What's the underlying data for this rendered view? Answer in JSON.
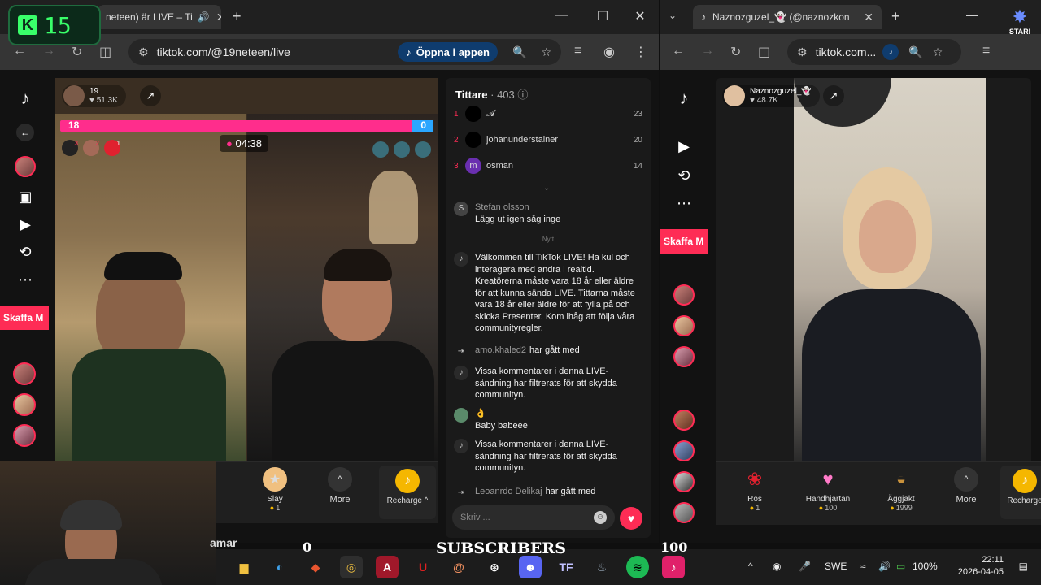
{
  "overlay": {
    "counter_logo": "K",
    "counter_value": "15",
    "stari_label": "STARI"
  },
  "left_window": {
    "tab_title": "neteen) är LIVE – Ti",
    "url": "tiktok.com/@19neteen/live",
    "open_in_app": "Öppna i appen",
    "win_controls": {
      "minimize": "—",
      "maximize": "☐",
      "close": "✕"
    }
  },
  "right_window": {
    "tab_title": "Naznozguzel_👻 (@naznozkon",
    "url": "tiktok.com..."
  },
  "tiktok_rail": {
    "get_coins_button": "Skaffa M"
  },
  "live_left": {
    "host_name": "19",
    "host_likes": "51.3K",
    "pk_left_score": "18",
    "pk_right_score": "0",
    "pk_timer": "04:38",
    "rank_badges": [
      "3",
      "2",
      "1"
    ],
    "gifts": [
      {
        "name": "Slay",
        "price": "1",
        "icon": "slay-icon"
      }
    ],
    "more_label": "More",
    "recharge_label": "Recharge ^"
  },
  "chat": {
    "title": "Tittare",
    "viewer_count": "· 403",
    "top_viewers": [
      {
        "rank": "1",
        "name": "𝓐",
        "score": "23"
      },
      {
        "rank": "2",
        "name": "johanunderstainer",
        "score": "20"
      },
      {
        "rank": "3",
        "name": "osman",
        "score": "14",
        "initial": "m"
      }
    ],
    "messages": [
      {
        "user": "Stefan olsson",
        "text": "Lägg ut igen såg inge"
      },
      {
        "user": "",
        "text": "Nytt"
      },
      {
        "user": "",
        "text": "Välkommen till TikTok LIVE! Ha kul och interagera med andra i realtid. Kreatörerna måste vara 18 år eller äldre för att kunna sända LIVE. Tittarna måste vara 18 år eller äldre för att fylla på och skicka Presenter. Kom ihåg att följa våra communityregler."
      },
      {
        "user": "amo.khaled2",
        "text": "har gått med"
      },
      {
        "user": "",
        "text": "Vissa kommentarer i denna LIVE-sändning har filtrerats för att skydda communityn."
      },
      {
        "user": "👌",
        "text": "Baby babeee"
      },
      {
        "user": "",
        "text": "Vissa kommentarer i denna LIVE-sändning har filtrerats för att skydda communityn."
      },
      {
        "user": "Leoanrdo Delikaj",
        "text": "har gått med"
      }
    ],
    "input_placeholder": "Skriv ..."
  },
  "live_right": {
    "host_name": "Naznozguzel_👻",
    "host_likes": "48.7K",
    "gifts": [
      {
        "name": "Ros",
        "price": "1",
        "icon": "rose-icon"
      },
      {
        "name": "Handhjärtan",
        "price": "100",
        "icon": "heart-hands-icon"
      },
      {
        "name": "Äggjakt",
        "price": "1999",
        "icon": "egg-basket-icon"
      }
    ],
    "more_label": "More",
    "recharge_label": "Recharge"
  },
  "stream_overlay": {
    "subscribers_left": "0",
    "subscribers_label": "SUBSCRIBERS",
    "subscribers_right": "100",
    "cut_text": "amar"
  },
  "taskbar": {
    "language": "SWE",
    "battery": "100%",
    "time": "22:11",
    "date": "2026-04-05"
  },
  "colors": {
    "tiktok_red": "#fe2c55",
    "pk_pink": "#ff2d8c",
    "pk_blue": "#2aa6ff",
    "counter_green": "#39ff6a"
  }
}
